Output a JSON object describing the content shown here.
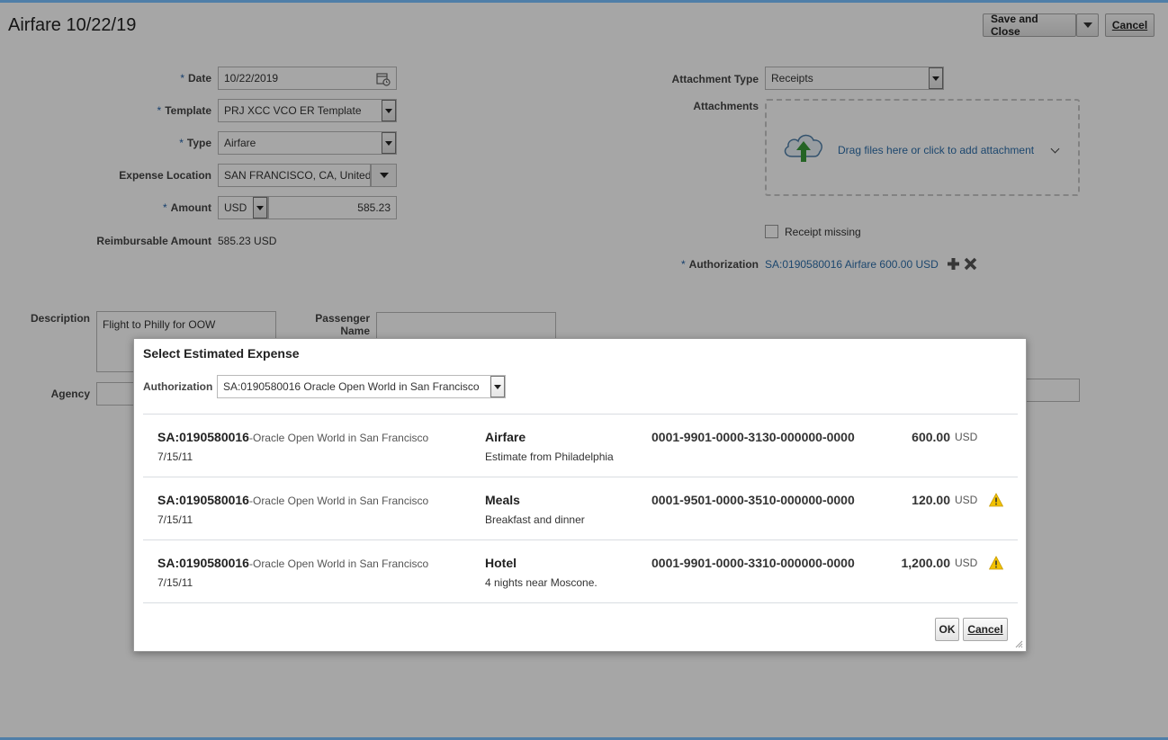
{
  "page": {
    "title": "Airfare 10/22/19"
  },
  "toolbar": {
    "save_close": "Save and Close",
    "cancel": "Cancel"
  },
  "form": {
    "date": {
      "label": "Date",
      "value": "10/22/2019"
    },
    "template": {
      "label": "Template",
      "value": "PRJ XCC VCO ER Template"
    },
    "type": {
      "label": "Type",
      "value": "Airfare"
    },
    "location": {
      "label": "Expense Location",
      "value": "SAN FRANCISCO, CA, United"
    },
    "amount": {
      "label": "Amount",
      "currency": "USD",
      "value": "585.23"
    },
    "reimbursable": {
      "label": "Reimbursable Amount",
      "value": "585.23 USD"
    },
    "attachment_type": {
      "label": "Attachment Type",
      "value": "Receipts"
    },
    "attachments": {
      "label": "Attachments",
      "drop_text": "Drag files here or click to add attachment"
    },
    "receipt_missing": {
      "label": "Receipt missing",
      "checked": false
    },
    "authorization": {
      "label": "Authorization",
      "value": "SA:0190580016 Airfare 600.00 USD"
    },
    "description": {
      "label": "Description",
      "value": "Flight to Philly for OOW"
    },
    "passenger": {
      "label": "Passenger Name",
      "value": ""
    },
    "agency": {
      "label": "Agency",
      "value": ""
    }
  },
  "dialog": {
    "title": "Select Estimated Expense",
    "authorization_label": "Authorization",
    "authorization_value": "SA:0190580016 Oracle Open World in San Francisco",
    "rows": [
      {
        "sa": "SA:0190580016",
        "sa_desc": "-Oracle Open World in San Francisco",
        "date": "7/15/11",
        "category": "Airfare",
        "category_desc": "Estimate from Philadelphia",
        "account": "0001-9901-0000-3130-000000-0000",
        "amount": "600.00",
        "currency": "USD",
        "warning": false
      },
      {
        "sa": "SA:0190580016",
        "sa_desc": "-Oracle Open World in San Francisco",
        "date": "7/15/11",
        "category": "Meals",
        "category_desc": "Breakfast and dinner",
        "account": "0001-9501-0000-3510-000000-0000",
        "amount": "120.00",
        "currency": "USD",
        "warning": true
      },
      {
        "sa": "SA:0190580016",
        "sa_desc": "-Oracle Open World in San Francisco",
        "date": "7/15/11",
        "category": "Hotel",
        "category_desc": "4 nights near Moscone.",
        "account": "0001-9901-0000-3310-000000-0000",
        "amount": "1,200.00",
        "currency": "USD",
        "warning": true
      }
    ],
    "ok": "OK",
    "cancel": "Cancel"
  },
  "colors": {
    "accent": "#2d6eaa",
    "warning": "#f2c200",
    "header_bar": "#4f7ea8"
  }
}
